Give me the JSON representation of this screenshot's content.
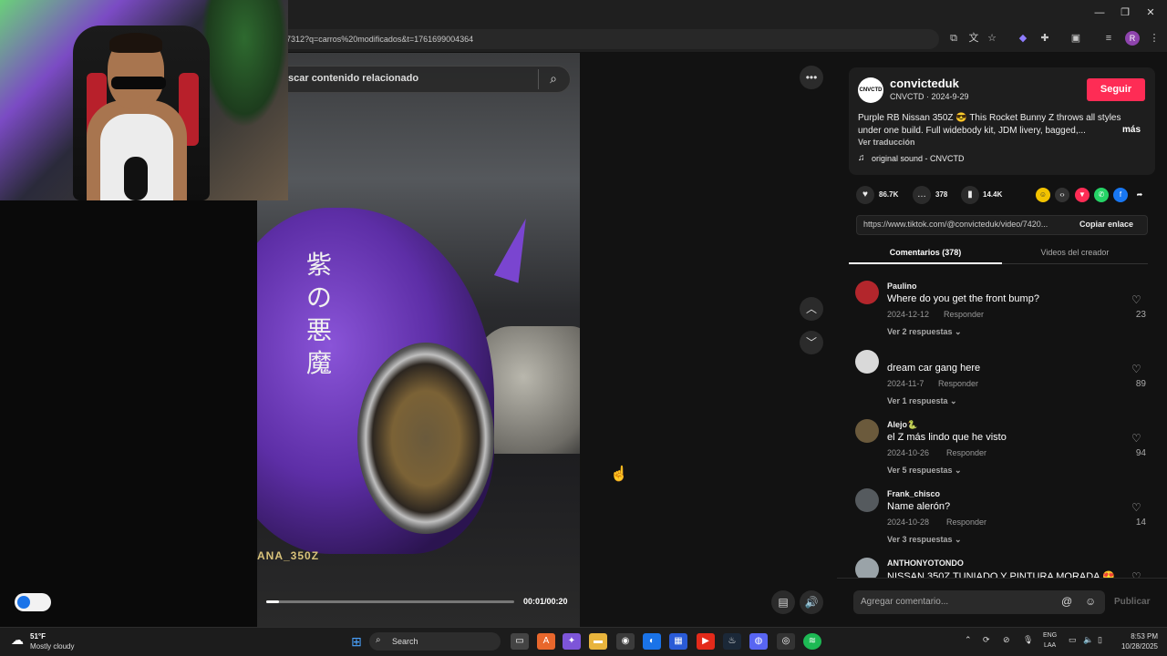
{
  "browser": {
    "url": "7312?q=carros%20modificados&t=1761699004364",
    "window_controls": [
      "—",
      "❐",
      "✕"
    ]
  },
  "search": {
    "placeholder": "scar contenido relacionado"
  },
  "video": {
    "kanji": [
      "紫",
      "の",
      "悪",
      "魔"
    ],
    "plate_text": "ANA_350Z",
    "time": "00:01/00:20",
    "progress": 0.05
  },
  "author": {
    "avatar_text": "CNVCTD",
    "name": "convicteduk",
    "sub": "CNVCTD · 2024-9-29",
    "follow": "Seguir",
    "description": "Purple RB Nissan 350Z 😎 This Rocket Bunny Z throws all styles under one build. Full widebody kit, JDM livery, bagged,...",
    "more": "más",
    "translate": "Ver traducción",
    "sound": "original sound - CNVCTD"
  },
  "stats": {
    "likes": "86.7K",
    "comments": "378",
    "saves": "14.4K"
  },
  "link": {
    "url": "https://www.tiktok.com/@convicteduk/video/7420...",
    "copy": "Copiar enlace"
  },
  "tabs": {
    "comments": "Comentarios (378)",
    "videos": "Videos del creador"
  },
  "comments": [
    {
      "user": "Paulino",
      "text": "Where do you get the front bump?",
      "date": "2024-12-12",
      "reply": "Responder",
      "replies": "Ver 2 respuestas ⌄",
      "likes": "23",
      "avatar_color": "#b3262c"
    },
    {
      "user": "",
      "text": "dream car gang here",
      "date": "2024-11-7",
      "reply": "Responder",
      "replies": "Ver 1 respuesta ⌄",
      "likes": "89",
      "avatar_color": "#d9d9d9"
    },
    {
      "user": "Alejo🐍",
      "text": "el Z más lindo que he visto",
      "date": "2024-10-26",
      "reply": "Responder",
      "replies": "Ver 5 respuestas ⌄",
      "likes": "94",
      "avatar_color": "#6b5a3c"
    },
    {
      "user": "Frank_chisco",
      "text": "Name alerón?",
      "date": "2024-10-28",
      "reply": "Responder",
      "replies": "Ver 3 respuestas ⌄",
      "likes": "14",
      "avatar_color": "#555a5e"
    },
    {
      "user": "ANTHONYOTONDO",
      "text": "NISSAN 350Z TUNIADO Y PINTURA MORADA 😍",
      "date": "",
      "reply": "",
      "replies": "",
      "likes": "",
      "avatar_color": "#9aa3a8"
    }
  ],
  "comment_bar": {
    "placeholder": "Agregar comentario...",
    "publish": "Publicar"
  },
  "taskbar": {
    "temp": "51°F",
    "weather": "Mostly cloudy",
    "search": "Search",
    "lang1": "ENG",
    "lang2": "LAA",
    "time": "8:53 PM",
    "date": "10/28/2025"
  }
}
